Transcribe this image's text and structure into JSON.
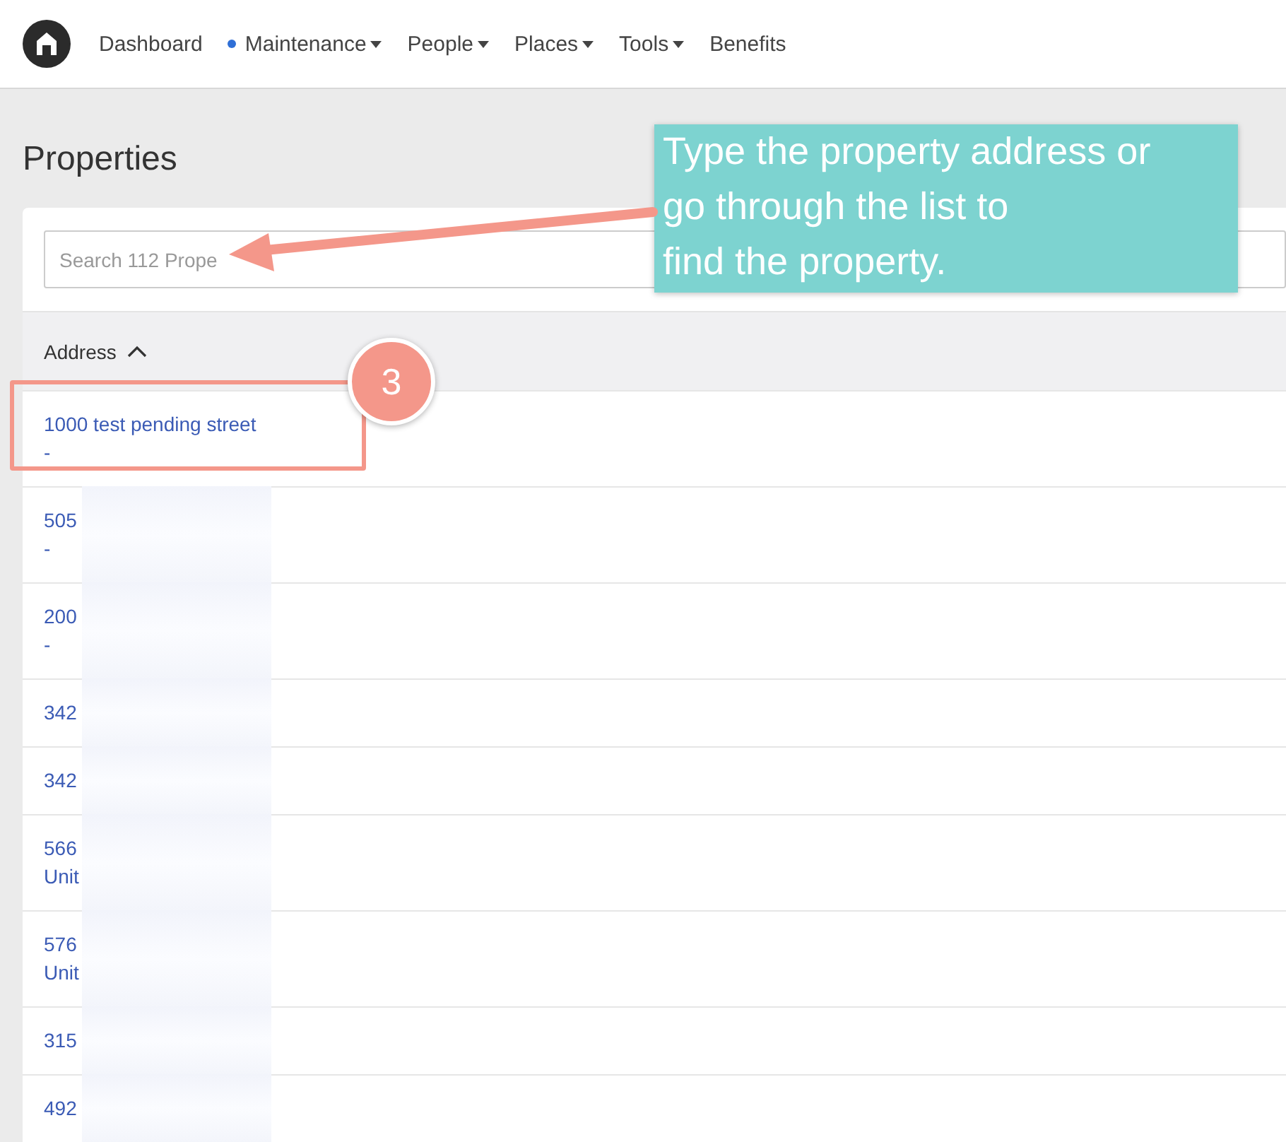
{
  "nav": {
    "items": [
      {
        "label": "Dashboard",
        "dropdown": false,
        "dot": false
      },
      {
        "label": "Maintenance",
        "dropdown": true,
        "dot": true
      },
      {
        "label": "People",
        "dropdown": true,
        "dot": false
      },
      {
        "label": "Places",
        "dropdown": true,
        "dot": false
      },
      {
        "label": "Tools",
        "dropdown": true,
        "dot": false
      },
      {
        "label": "Benefits",
        "dropdown": false,
        "dot": false
      }
    ]
  },
  "page_title": "Properties",
  "search": {
    "placeholder": "Search 112 Prope"
  },
  "table": {
    "columns": [
      {
        "label": "Address",
        "sort_ascending": true
      }
    ],
    "rows": [
      {
        "lines": [
          "1000 test pending street",
          "-"
        ],
        "redacted": false,
        "highlighted": true
      },
      {
        "lines": [
          "505",
          "-"
        ],
        "redacted": true,
        "highlighted": false
      },
      {
        "lines": [
          "200",
          "-"
        ],
        "redacted": true,
        "highlighted": false
      },
      {
        "lines": [
          "342"
        ],
        "redacted": true,
        "highlighted": false
      },
      {
        "lines": [
          "342"
        ],
        "redacted": true,
        "highlighted": false
      },
      {
        "lines": [
          "566",
          "Unit"
        ],
        "redacted": true,
        "highlighted": false
      },
      {
        "lines": [
          "576",
          "Unit"
        ],
        "redacted": true,
        "highlighted": false
      },
      {
        "lines": [
          "315"
        ],
        "redacted": true,
        "highlighted": false
      },
      {
        "lines": [
          "492"
        ],
        "redacted": true,
        "highlighted": false
      }
    ]
  },
  "annotation": {
    "callout": "Type the property address or\ngo through the list to\nfind the property.",
    "step": "3"
  }
}
